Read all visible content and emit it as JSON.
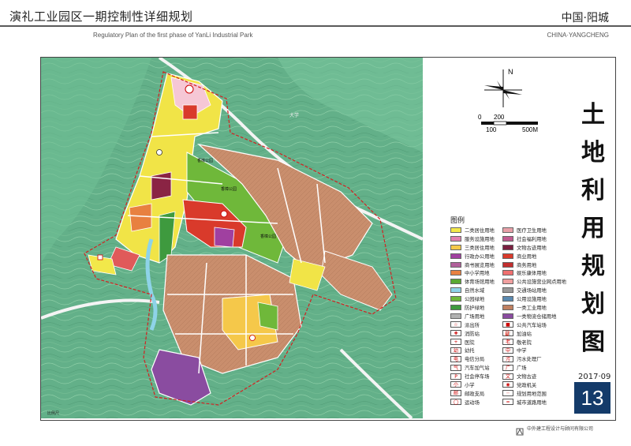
{
  "header": {
    "title": "演礼工业园区一期控制性详细规划",
    "subtitle": "Regulatory Plan of the first phase of YanLi Industrial Park",
    "location": "中国·阳城",
    "location_en": "CHINA·YANGCHENG"
  },
  "sheet": {
    "title_chars": [
      "土",
      "地",
      "利",
      "用",
      "规",
      "划",
      "图"
    ],
    "date": "2017·09",
    "number": "13",
    "company": "中外建工程设计与顾问有限公司"
  },
  "compass": {
    "north_label": "N"
  },
  "scale_bar": {
    "label_0": "0",
    "label_200": "200",
    "label_100": "100",
    "label_500": "500M"
  },
  "map_labels": {
    "park_a": "香樟公园",
    "park_b": "香樟公园",
    "park_c": "香樟公园",
    "road": "大学",
    "bottom_left": "比例尺"
  },
  "legend": {
    "heading": "图例",
    "items": [
      {
        "label": "二类居住用地",
        "color": "#f2e84a",
        "kind": "swatch"
      },
      {
        "label": "医疗卫生用地",
        "color": "#e8a0a8",
        "kind": "swatch"
      },
      {
        "label": "服务设施用地",
        "color": "#e07fb0",
        "kind": "swatch"
      },
      {
        "label": "社会福利用地",
        "color": "#c05a90",
        "kind": "swatch"
      },
      {
        "label": "三类居住用地",
        "color": "#f5c84a",
        "kind": "swatch"
      },
      {
        "label": "文物古迹用地",
        "color": "#7a2040",
        "kind": "swatch"
      },
      {
        "label": "行政办公用地",
        "color": "#a040a0",
        "kind": "swatch"
      },
      {
        "label": "商业用地",
        "color": "#d93a2b",
        "kind": "swatch"
      },
      {
        "label": "商书展览用地",
        "color": "#b0609a",
        "kind": "swatch"
      },
      {
        "label": "商务用地",
        "color": "#c22e2e",
        "kind": "swatch"
      },
      {
        "label": "中小学用地",
        "color": "#e88040",
        "kind": "swatch"
      },
      {
        "label": "娱乐康体用地",
        "color": "#f07070",
        "kind": "swatch"
      },
      {
        "label": "体育场馆用地",
        "color": "#5aa832",
        "kind": "swatch"
      },
      {
        "label": "公共设施营业网点用地",
        "color": "#f0a0a0",
        "kind": "swatch"
      },
      {
        "label": "自然水域",
        "color": "#8ed3e8",
        "kind": "swatch"
      },
      {
        "label": "交通场站用地",
        "color": "#9a9a9a",
        "kind": "swatch"
      },
      {
        "label": "公园绿地",
        "color": "#6fb83a",
        "kind": "swatch"
      },
      {
        "label": "公用设施用地",
        "color": "#5a8ab0",
        "kind": "swatch"
      },
      {
        "label": "防护绿地",
        "color": "#3e9a3e",
        "kind": "swatch"
      },
      {
        "label": "一类工业用地",
        "color": "#c08060",
        "kind": "swatch"
      },
      {
        "label": "广场用地",
        "color": "#b0b0b0",
        "kind": "swatch"
      },
      {
        "label": "一类物流仓储用地",
        "color": "#8a4ca0",
        "kind": "swatch"
      },
      {
        "label": "派出所",
        "symbol": "☆",
        "kind": "symbol"
      },
      {
        "label": "公共汽车站场",
        "symbol": "■",
        "kind": "symbol"
      },
      {
        "label": "消防站",
        "symbol": "✚",
        "kind": "symbol"
      },
      {
        "label": "加油站",
        "symbol": "⛽",
        "kind": "symbol"
      },
      {
        "label": "医院",
        "symbol": "+",
        "kind": "symbol"
      },
      {
        "label": "敬老院",
        "symbol": "老",
        "kind": "symbol"
      },
      {
        "label": "幼托",
        "symbol": "幼",
        "kind": "symbol"
      },
      {
        "label": "中学",
        "symbol": "中",
        "kind": "symbol"
      },
      {
        "label": "电信分局",
        "symbol": "电",
        "kind": "symbol"
      },
      {
        "label": "污水处理厂",
        "symbol": "污",
        "kind": "symbol"
      },
      {
        "label": "汽车加气站",
        "symbol": "气",
        "kind": "symbol"
      },
      {
        "label": "广场",
        "symbol": "广",
        "kind": "symbol"
      },
      {
        "label": "社会停车场",
        "symbol": "P",
        "kind": "symbol"
      },
      {
        "label": "文物古迹",
        "symbol": "文",
        "kind": "symbol"
      },
      {
        "label": "小学",
        "symbol": "小",
        "kind": "symbol"
      },
      {
        "label": "党政机关",
        "symbol": "◉",
        "kind": "symbol"
      },
      {
        "label": "邮政支局",
        "symbol": "邮",
        "kind": "symbol"
      },
      {
        "label": "规划用地范围",
        "symbol": "┈",
        "kind": "symbol"
      },
      {
        "label": "运动场",
        "symbol": "◯",
        "kind": "symbol"
      },
      {
        "label": "城市道路用地",
        "symbol": "═",
        "kind": "symbol"
      }
    ]
  }
}
